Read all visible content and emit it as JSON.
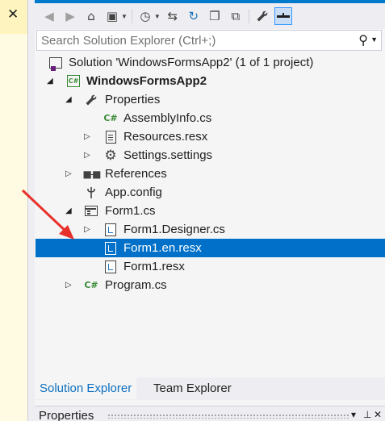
{
  "left_panel": {
    "close_glyph": "✕"
  },
  "toolbar": {
    "buttons": [
      {
        "icon": "back-icon",
        "glyph": "◀"
      },
      {
        "icon": "forward-icon",
        "glyph": "▶"
      },
      {
        "icon": "home-icon",
        "glyph": "⌂"
      },
      {
        "icon": "switch-views-icon",
        "glyph": "▣"
      },
      {
        "icon": "pending-changes-filter-icon",
        "glyph": "◷"
      },
      {
        "icon": "sync-with-active-document-icon",
        "glyph": "⇆"
      },
      {
        "icon": "refresh-icon",
        "glyph": "↻"
      },
      {
        "icon": "collapse-all-icon",
        "glyph": "❐"
      },
      {
        "icon": "show-all-files-icon",
        "glyph": "⧉"
      },
      {
        "icon": "properties-wrench-icon",
        "glyph": "🔧"
      },
      {
        "icon": "preview-selected-items-icon",
        "glyph": "▬"
      }
    ]
  },
  "search": {
    "placeholder": "Search Solution Explorer (Ctrl+;)",
    "value": ""
  },
  "tree": [
    {
      "label": "Solution 'WindowsFormsApp2' (1 of 1 project)",
      "icon": "solution-icon",
      "expander": "",
      "bold": false
    },
    {
      "label": "WindowsFormsApp2",
      "icon": "csharp-project-icon",
      "expander": "◢",
      "bold": true
    },
    {
      "label": "Properties",
      "icon": "wrench-icon",
      "expander": "◢",
      "bold": false
    },
    {
      "label": "AssemblyInfo.cs",
      "icon": "csharp-file-icon",
      "expander": "",
      "bold": false
    },
    {
      "label": "Resources.resx",
      "icon": "resource-file-icon",
      "expander": "▷",
      "bold": false
    },
    {
      "label": "Settings.settings",
      "icon": "settings-gear-icon",
      "expander": "▷",
      "bold": false
    },
    {
      "label": "References",
      "icon": "references-icon",
      "expander": "▷",
      "bold": false
    },
    {
      "label": "App.config",
      "icon": "config-file-icon",
      "expander": "",
      "bold": false
    },
    {
      "label": "Form1.cs",
      "icon": "form-icon",
      "expander": "◢",
      "bold": false
    },
    {
      "label": "Form1.Designer.cs",
      "icon": "designer-file-icon",
      "expander": "▷",
      "bold": false
    },
    {
      "label": "Form1.en.resx",
      "icon": "resx-file-icon",
      "expander": "",
      "bold": false,
      "selected": true
    },
    {
      "label": "Form1.resx",
      "icon": "resx-file-icon",
      "expander": "",
      "bold": false
    },
    {
      "label": "Program.cs",
      "icon": "csharp-file-icon",
      "expander": "▷",
      "bold": false
    }
  ],
  "tabs": [
    {
      "label": "Solution Explorer",
      "active": true
    },
    {
      "label": "Team Explorer",
      "active": false
    }
  ],
  "properties_panel": {
    "title": "Properties",
    "dropdown_glyph": "▾",
    "pin_glyph": "⊥",
    "close_glyph": "✕"
  },
  "colors": {
    "accent": "#007acc",
    "selection": "#0070c9",
    "annotation_arrow": "#e8302a"
  }
}
